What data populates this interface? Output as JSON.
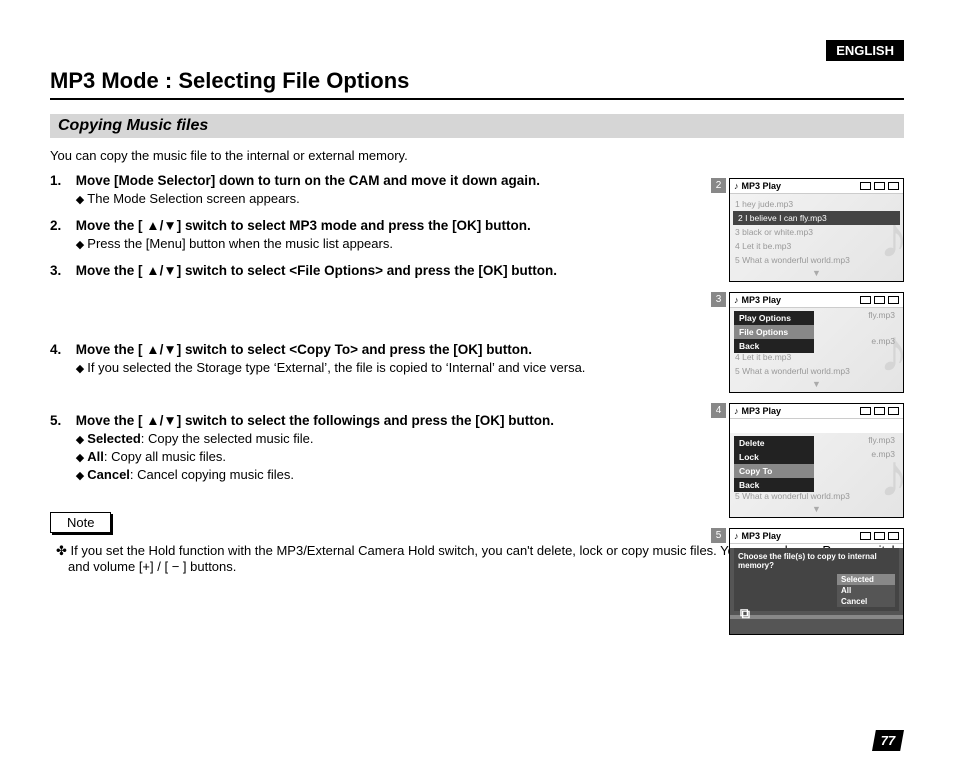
{
  "lang_badge": "ENGLISH",
  "page_title": "MP3 Mode : Selecting File Options",
  "section_title": "Copying Music files",
  "intro": "You can copy the music file to the internal or external memory.",
  "steps": [
    {
      "num": "1.",
      "head": "Move [Mode Selector] down to turn on the CAM and move it down again.",
      "subs": [
        "The Mode Selection screen appears."
      ]
    },
    {
      "num": "2.",
      "head": "Move the [ ▲/▼] switch to select MP3 mode and press the [OK] button.",
      "subs": [
        "Press the [Menu] button when the music list appears."
      ]
    },
    {
      "num": "3.",
      "head": "Move the [ ▲/▼] switch to select <File Options> and press the [OK] button.",
      "subs": []
    },
    {
      "num": "4.",
      "head": "Move the [ ▲/▼] switch to select <Copy To> and press the [OK] button.",
      "subs": [
        "If you selected the Storage type ‘External’, the file is copied to ‘Internal’ and vice versa."
      ]
    },
    {
      "num": "5.",
      "head": "Move the [ ▲/▼] switch to select the followings and press the [OK] button.",
      "subs": [],
      "labeled_subs": [
        {
          "b": "Selected",
          "t": ": Copy the selected music file."
        },
        {
          "b": "All",
          "t": ": Copy all music files."
        },
        {
          "b": "Cancel",
          "t": ": Cancel copying music files."
        }
      ]
    }
  ],
  "note_label": "Note",
  "note_body": "If you set the Hold function with the MP3/External Camera Hold switch, you can't delete, lock or copy music files. You can only use Power switch and volume [+] / [ − ] buttons.",
  "page_number": "77",
  "screen_header_title": "MP3 Play",
  "tracks": [
    "1  hey jude.mp3",
    "2  I believe I can fly.mp3",
    "3  black or white.mp3",
    "4  Let it be.mp3",
    "5  What a wonderful world.mp3"
  ],
  "tracks_frag": {
    "fly": "fly.mp3",
    "e": "e.mp3"
  },
  "menu3": [
    "Play Options",
    "File Options",
    "Back"
  ],
  "menu4": [
    "Delete",
    "Lock",
    "Copy To",
    "Back"
  ],
  "prompt": "Choose the file(s) to copy to internal memory?",
  "prompt_opts": [
    "Selected",
    "All",
    "Cancel"
  ],
  "screen_nums": [
    "2",
    "3",
    "4",
    "5"
  ]
}
